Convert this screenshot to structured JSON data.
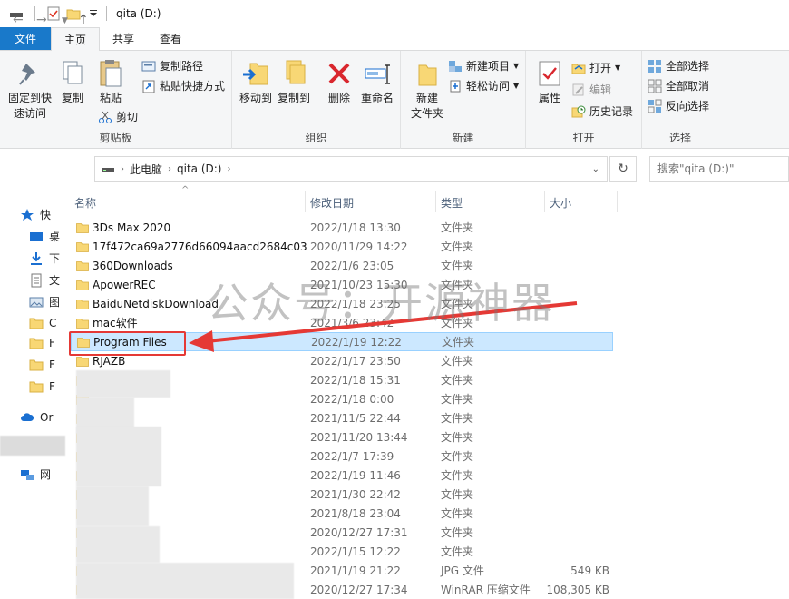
{
  "window": {
    "title": "qita (D:)"
  },
  "tabs": [
    {
      "label": "文件"
    },
    {
      "label": "主页"
    },
    {
      "label": "共享"
    },
    {
      "label": "查看"
    }
  ],
  "ribbon": {
    "clipboard": {
      "title": "剪贴板",
      "pin": "固定到快\n速访问",
      "copy": "复制",
      "paste": "粘贴",
      "copy_path": "复制路径",
      "paste_shortcut": "粘贴快捷方式",
      "cut": "剪切"
    },
    "organize": {
      "title": "组织",
      "move_to": "移动到",
      "copy_to": "复制到",
      "delete": "删除",
      "rename": "重命名"
    },
    "new": {
      "title": "新建",
      "new_folder": "新建\n文件夹",
      "new_item": "新建项目",
      "easy_access": "轻松访问"
    },
    "open": {
      "title": "打开",
      "properties": "属性",
      "open": "打开",
      "edit": "编辑",
      "history": "历史记录"
    },
    "select": {
      "title": "选择",
      "select_all": "全部选择",
      "select_none": "全部取消",
      "invert": "反向选择"
    }
  },
  "address": {
    "crumbs": [
      "此电脑",
      "qita (D:)"
    ],
    "search_placeholder": "搜索\"qita (D:)\""
  },
  "navpane": {
    "items": [
      {
        "label": "快",
        "icon": "star-icon"
      },
      {
        "label": "桌",
        "icon": "desktop-icon"
      },
      {
        "label": "下",
        "icon": "download-icon"
      },
      {
        "label": "文",
        "icon": "document-icon"
      },
      {
        "label": "图",
        "icon": "picture-icon"
      },
      {
        "label": "C",
        "icon": "folder-icon"
      },
      {
        "label": "F",
        "icon": "folder-icon"
      },
      {
        "label": "F",
        "icon": "folder-icon"
      },
      {
        "label": "F",
        "icon": "folder-icon"
      },
      {
        "label": "Or",
        "icon": "cloud-icon"
      },
      {
        "label": "",
        "icon": "pc-icon"
      },
      {
        "label": "网",
        "icon": "network-icon"
      }
    ]
  },
  "columns": {
    "name": "名称",
    "date": "修改日期",
    "type": "类型",
    "size": "大小"
  },
  "files": [
    {
      "name": "3Ds Max 2020",
      "date": "2022/1/18 13:30",
      "type": "文件夹",
      "size": ""
    },
    {
      "name": "17f472ca69a2776d66094aacd2684c03",
      "date": "2020/11/29 14:22",
      "type": "文件夹",
      "size": ""
    },
    {
      "name": "360Downloads",
      "date": "2022/1/6 23:05",
      "type": "文件夹",
      "size": ""
    },
    {
      "name": "ApowerREC",
      "date": "2021/10/23 15:30",
      "type": "文件夹",
      "size": ""
    },
    {
      "name": "BaiduNetdiskDownload",
      "date": "2022/1/18 23:25",
      "type": "文件夹",
      "size": ""
    },
    {
      "name": "mac软件",
      "date": "2021/3/6 23:42",
      "type": "文件夹",
      "size": ""
    },
    {
      "name": "Program Files",
      "date": "2022/1/19 12:22",
      "type": "文件夹",
      "size": ""
    },
    {
      "name": "RJAZB",
      "date": "2022/1/17 23:50",
      "type": "文件夹",
      "size": ""
    },
    {
      "name": "",
      "date": "2022/1/18 15:31",
      "type": "文件夹",
      "size": ""
    },
    {
      "name": "",
      "date": "2022/1/18 0:00",
      "type": "文件夹",
      "size": ""
    },
    {
      "name": "",
      "date": "2021/11/5 22:44",
      "type": "文件夹",
      "size": ""
    },
    {
      "name": "",
      "date": "2021/11/20 13:44",
      "type": "文件夹",
      "size": ""
    },
    {
      "name": "",
      "date": "2022/1/7 17:39",
      "type": "文件夹",
      "size": ""
    },
    {
      "name": "",
      "date": "2022/1/19 11:46",
      "type": "文件夹",
      "size": ""
    },
    {
      "name": "",
      "date": "2021/1/30 22:42",
      "type": "文件夹",
      "size": ""
    },
    {
      "name": "",
      "date": "2021/8/18 23:04",
      "type": "文件夹",
      "size": ""
    },
    {
      "name": "",
      "date": "2020/12/27 17:31",
      "type": "文件夹",
      "size": ""
    },
    {
      "name": "",
      "date": "2022/1/15 12:22",
      "type": "文件夹",
      "size": ""
    },
    {
      "name": "",
      "date": "2021/1/19 21:22",
      "type": "JPG 文件",
      "size": "549 KB"
    },
    {
      "name": "",
      "date": "2020/12/27 17:34",
      "type": "WinRAR 压缩文件",
      "size": "108,305 KB"
    }
  ],
  "watermark": "公众号：开源神器",
  "colors": {
    "accent": "#1979ca",
    "selection": "#cce8ff",
    "highlight": "#e53935",
    "folder": "#f8d775"
  }
}
